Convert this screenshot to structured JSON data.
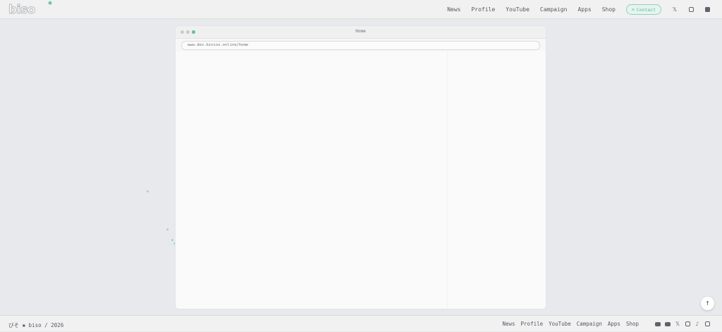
{
  "header": {
    "logo_text": "biso",
    "nav": [
      "News",
      "Profile",
      "YouTube",
      "Campaign",
      "Apps",
      "Shop"
    ],
    "contact_label": "Contact",
    "social_icons": [
      "x-icon",
      "instagram-icon",
      "bluesky-icon"
    ]
  },
  "browser": {
    "title": "Home",
    "url": "www.dev.biniso.online/home"
  },
  "footer": {
    "copyright": "びそ ✱ biso / 2026",
    "nav": [
      "News",
      "Profile",
      "YouTube",
      "Campaign",
      "Apps",
      "Shop"
    ],
    "social_icons": [
      "youtube-icon",
      "youtube-icon",
      "x-icon",
      "instagram-icon",
      "tiktok-icon",
      "bluesky-icon"
    ]
  },
  "colors": {
    "accent": "#5bbfa6",
    "background": "#e8e9ec"
  },
  "scroll_top_icon": "arrow-up-icon"
}
